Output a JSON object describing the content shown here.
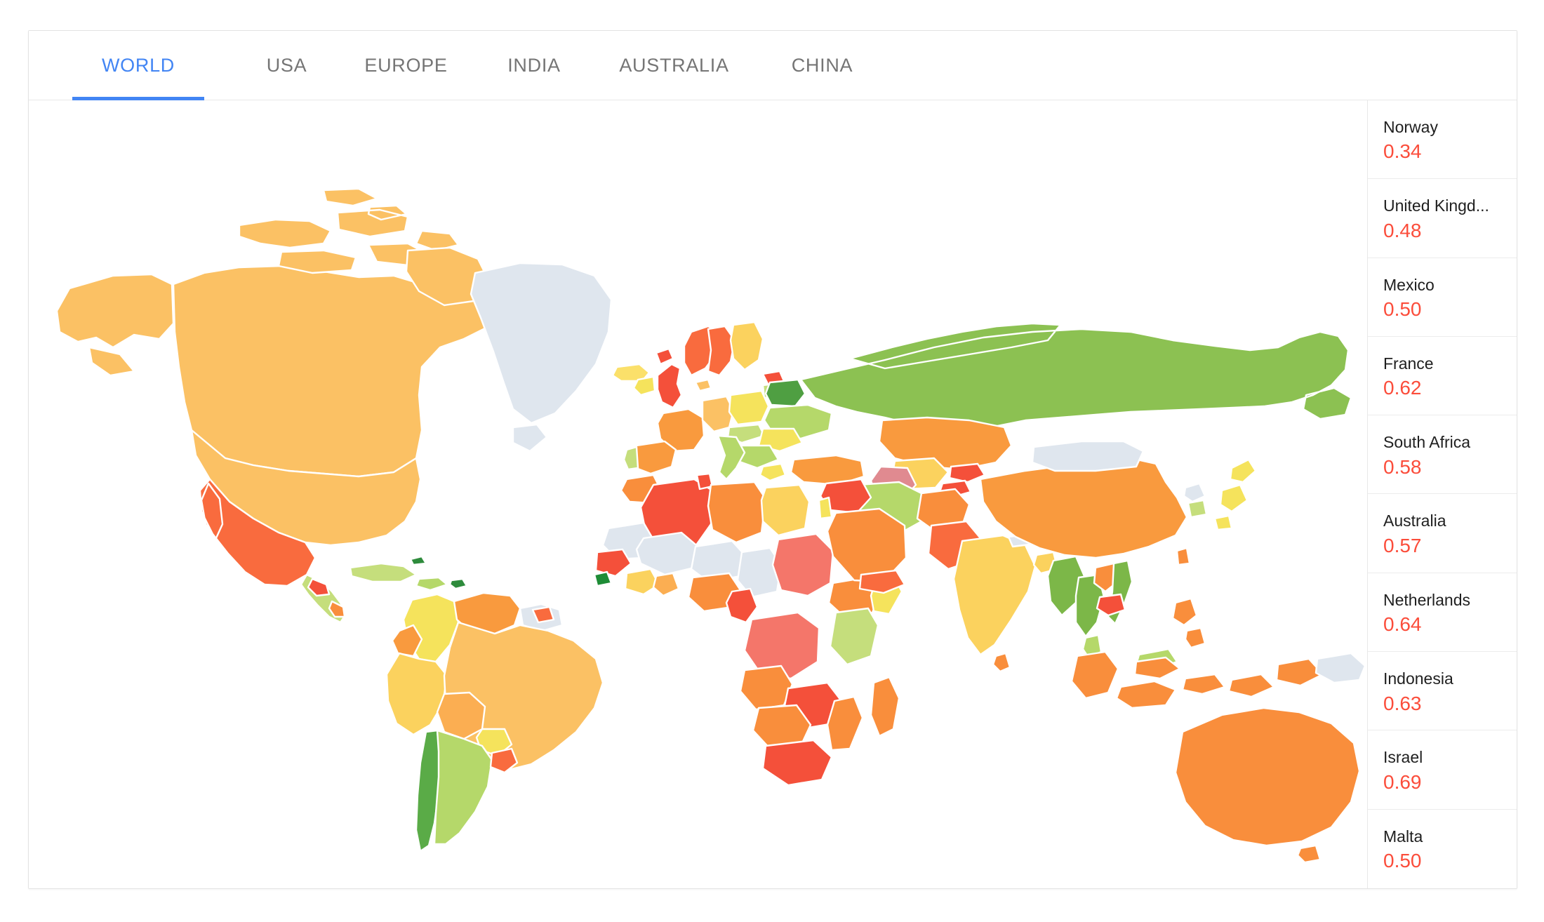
{
  "theme": {
    "accent": "#4285f4",
    "value_color": "#fb4d3b",
    "tab_inactive": "#757575",
    "card_border": "#e3e3e3",
    "divider": "#ececec",
    "no_data": "#dfe6ee",
    "map_stroke": "#ffffff"
  },
  "tabs": [
    {
      "label": "WORLD",
      "active": true
    },
    {
      "label": "USA",
      "active": false
    },
    {
      "label": "EUROPE",
      "active": false
    },
    {
      "label": "INDIA",
      "active": false
    },
    {
      "label": "AUSTRALIA",
      "active": false
    },
    {
      "label": "CHINA",
      "active": false
    }
  ],
  "ranking": [
    {
      "name": "Norway",
      "value": "0.34"
    },
    {
      "name": "United Kingd...",
      "value": "0.48"
    },
    {
      "name": "Mexico",
      "value": "0.50"
    },
    {
      "name": "France",
      "value": "0.62"
    },
    {
      "name": "South Africa",
      "value": "0.58"
    },
    {
      "name": "Australia",
      "value": "0.57"
    },
    {
      "name": "Netherlands",
      "value": "0.64"
    },
    {
      "name": "Indonesia",
      "value": "0.63"
    },
    {
      "name": "Israel",
      "value": "0.69"
    },
    {
      "name": "Malta",
      "value": "0.50"
    }
  ],
  "chart_data": {
    "type": "heatmap",
    "subtype": "choropleth-world-map",
    "title": "",
    "legend": "none",
    "value_range": [
      0.3,
      0.75
    ],
    "no_data_color": "#dfe6ee",
    "color_scale": [
      {
        "stop": 0.0,
        "color": "#34a853"
      },
      {
        "stop": 0.18,
        "color": "#8cc152"
      },
      {
        "stop": 0.35,
        "color": "#b5d86a"
      },
      {
        "stop": 0.5,
        "color": "#f5e35c"
      },
      {
        "stop": 0.62,
        "color": "#fbd25e"
      },
      {
        "stop": 0.72,
        "color": "#fbc164"
      },
      {
        "stop": 0.82,
        "color": "#f99a3e"
      },
      {
        "stop": 0.9,
        "color": "#f98e3c"
      },
      {
        "stop": 0.96,
        "color": "#f96b3e"
      },
      {
        "stop": 1.0,
        "color": "#f4503a"
      }
    ],
    "highlighted_countries": [
      {
        "name": "Norway",
        "value": 0.34,
        "color": "#f96b3e"
      },
      {
        "name": "United Kingdom",
        "value": 0.48,
        "color": "#f4503a"
      },
      {
        "name": "Mexico",
        "value": 0.5,
        "color": "#f96b3e"
      },
      {
        "name": "France",
        "value": 0.62,
        "color": "#f99a3e"
      },
      {
        "name": "South Africa",
        "value": 0.58,
        "color": "#f4503a"
      },
      {
        "name": "Australia",
        "value": 0.57,
        "color": "#f98e3c"
      },
      {
        "name": "Netherlands",
        "value": 0.64,
        "color": "#fbc164"
      },
      {
        "name": "Indonesia",
        "value": 0.63,
        "color": "#f98e3c"
      },
      {
        "name": "Israel",
        "value": 0.69,
        "color": "#f5e35c"
      },
      {
        "name": "Malta",
        "value": 0.5,
        "color": "#f4503a"
      }
    ],
    "region_colors": [
      {
        "region": "Canada",
        "color": "#fbc164"
      },
      {
        "region": "United States",
        "color": "#fbc164"
      },
      {
        "region": "Alaska",
        "color": "#fbc164"
      },
      {
        "region": "Greenland",
        "color": "#dfe6ee"
      },
      {
        "region": "Mexico",
        "color": "#f96b3e"
      },
      {
        "region": "Brazil",
        "color": "#fbc164"
      },
      {
        "region": "Argentina",
        "color": "#b5d86a"
      },
      {
        "region": "Chile",
        "color": "#5aab47"
      },
      {
        "region": "Colombia",
        "color": "#f5e35c"
      },
      {
        "region": "Peru",
        "color": "#fbd25e"
      },
      {
        "region": "Venezuela",
        "color": "#f99a3e"
      },
      {
        "region": "Bolivia",
        "color": "#fbae52"
      },
      {
        "region": "Uruguay",
        "color": "#f96b3e"
      },
      {
        "region": "Ecuador",
        "color": "#f99a3e"
      },
      {
        "region": "Paraguay",
        "color": "#f5e35c"
      },
      {
        "region": "Guyana",
        "color": "#dfe6ee"
      },
      {
        "region": "Russia",
        "color": "#8cc152"
      },
      {
        "region": "China",
        "color": "#f99a3e"
      },
      {
        "region": "Mongolia",
        "color": "#dfe6ee"
      },
      {
        "region": "Kazakhstan",
        "color": "#f99a3e"
      },
      {
        "region": "India",
        "color": "#fbd25e"
      },
      {
        "region": "Japan",
        "color": "#f5e35c"
      },
      {
        "region": "Australia",
        "color": "#f98e3c"
      },
      {
        "region": "New Zealand",
        "color": "#b5d86a"
      },
      {
        "region": "Indonesia",
        "color": "#f98e3c"
      },
      {
        "region": "Algeria",
        "color": "#f4503a"
      },
      {
        "region": "Libya",
        "color": "#f99a3e"
      },
      {
        "region": "Egypt",
        "color": "#fbd25e"
      },
      {
        "region": "Sudan",
        "color": "#f4766a"
      },
      {
        "region": "Chad",
        "color": "#dfe6ee"
      },
      {
        "region": "Niger",
        "color": "#dfe6ee"
      },
      {
        "region": "Mali",
        "color": "#dfe6ee"
      },
      {
        "region": "Saudi Arabia",
        "color": "#f99a3e"
      },
      {
        "region": "Iran",
        "color": "#b5d86a"
      },
      {
        "region": "Turkey",
        "color": "#f99a3e"
      },
      {
        "region": "Ukraine",
        "color": "#b5d86a"
      },
      {
        "region": "Belarus",
        "color": "#5aab47"
      },
      {
        "region": "Poland",
        "color": "#f5e35c"
      },
      {
        "region": "Germany",
        "color": "#fbc164"
      },
      {
        "region": "Spain",
        "color": "#f99a3e"
      },
      {
        "region": "Italy",
        "color": "#b5d86a"
      },
      {
        "region": "Sweden",
        "color": "#f96b3e"
      },
      {
        "region": "Finland",
        "color": "#fbd25e"
      },
      {
        "region": "Antarctica",
        "color": "#dfe6ee"
      }
    ]
  }
}
